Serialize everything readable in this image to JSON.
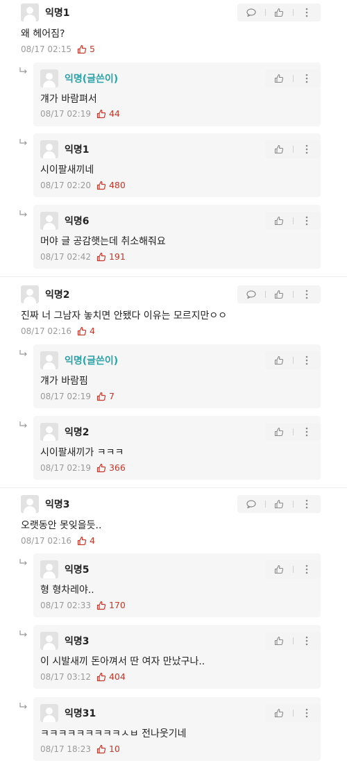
{
  "threads": [
    {
      "nick": "익명1",
      "text": "왜 헤어짐?",
      "time": "08/17 02:15",
      "likes": "5",
      "replies": [
        {
          "nick": "익명(글쓴이)",
          "op": true,
          "text": "걔가 바람펴서",
          "time": "08/17 02:19",
          "likes": "44"
        },
        {
          "nick": "익명1",
          "op": false,
          "text": "시이팔새끼네",
          "time": "08/17 02:20",
          "likes": "480"
        },
        {
          "nick": "익명6",
          "op": false,
          "text": "머야 글 공감햇는데 취소해줘요",
          "time": "08/17 02:42",
          "likes": "191"
        }
      ]
    },
    {
      "nick": "익명2",
      "text": "진짜 너 그남자 놓치면 안됐다 이유는 모르지만ㅇㅇ",
      "time": "08/17 02:16",
      "likes": "4",
      "replies": [
        {
          "nick": "익명(글쓴이)",
          "op": true,
          "text": "걔가 바람핌",
          "time": "08/17 02:19",
          "likes": "7"
        },
        {
          "nick": "익명2",
          "op": false,
          "text": "시이팔새끼가 ㅋㅋㅋ",
          "time": "08/17 02:19",
          "likes": "366"
        }
      ]
    },
    {
      "nick": "익명3",
      "text": "오랫동안 못잊을듯..",
      "time": "08/17 02:16",
      "likes": "4",
      "replies": [
        {
          "nick": "익명5",
          "op": false,
          "text": "형 형차레야..",
          "time": "08/17 02:33",
          "likes": "170"
        },
        {
          "nick": "익명3",
          "op": false,
          "text": "이 시발새끼 돈아껴서 딴 여자 만났구나..",
          "time": "08/17 03:12",
          "likes": "404"
        },
        {
          "nick": "익명31",
          "op": false,
          "text": "ㅋㅋㅋㅋㅋㅋㅋㅋㅋㅅㅂ 전나웃기네",
          "time": "08/17 18:23",
          "likes": "10"
        }
      ]
    }
  ],
  "icons": {
    "reply": "speech-bubble-icon",
    "like": "thumbs-up-icon",
    "more": "kebab-menu-icon",
    "reply_arrow": "reply-arrow-icon"
  },
  "colors": {
    "op_nick": "#2aa3a8",
    "like_count": "#c0392b",
    "meta": "#9a9a9a",
    "reply_bg": "#f6f6f6"
  }
}
